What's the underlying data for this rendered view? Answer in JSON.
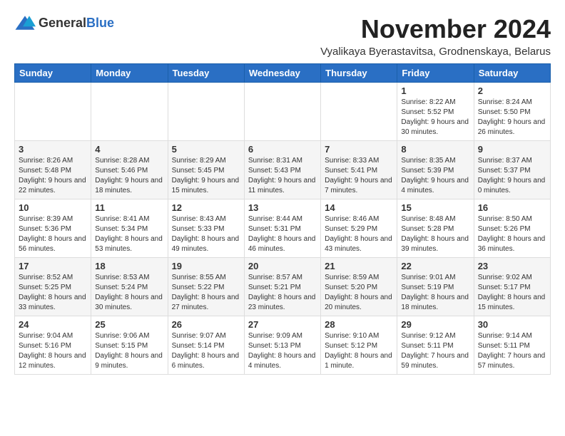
{
  "header": {
    "logo_general": "General",
    "logo_blue": "Blue",
    "month": "November 2024",
    "location": "Vyalikaya Byerastavitsa, Grodnenskaya, Belarus"
  },
  "weekdays": [
    "Sunday",
    "Monday",
    "Tuesday",
    "Wednesday",
    "Thursday",
    "Friday",
    "Saturday"
  ],
  "weeks": [
    [
      {
        "day": "",
        "sunrise": "",
        "sunset": "",
        "daylight": ""
      },
      {
        "day": "",
        "sunrise": "",
        "sunset": "",
        "daylight": ""
      },
      {
        "day": "",
        "sunrise": "",
        "sunset": "",
        "daylight": ""
      },
      {
        "day": "",
        "sunrise": "",
        "sunset": "",
        "daylight": ""
      },
      {
        "day": "",
        "sunrise": "",
        "sunset": "",
        "daylight": ""
      },
      {
        "day": "1",
        "sunrise": "8:22 AM",
        "sunset": "5:52 PM",
        "daylight": "9 hours and 30 minutes."
      },
      {
        "day": "2",
        "sunrise": "8:24 AM",
        "sunset": "5:50 PM",
        "daylight": "9 hours and 26 minutes."
      }
    ],
    [
      {
        "day": "3",
        "sunrise": "8:26 AM",
        "sunset": "5:48 PM",
        "daylight": "9 hours and 22 minutes."
      },
      {
        "day": "4",
        "sunrise": "8:28 AM",
        "sunset": "5:46 PM",
        "daylight": "9 hours and 18 minutes."
      },
      {
        "day": "5",
        "sunrise": "8:29 AM",
        "sunset": "5:45 PM",
        "daylight": "9 hours and 15 minutes."
      },
      {
        "day": "6",
        "sunrise": "8:31 AM",
        "sunset": "5:43 PM",
        "daylight": "9 hours and 11 minutes."
      },
      {
        "day": "7",
        "sunrise": "8:33 AM",
        "sunset": "5:41 PM",
        "daylight": "9 hours and 7 minutes."
      },
      {
        "day": "8",
        "sunrise": "8:35 AM",
        "sunset": "5:39 PM",
        "daylight": "9 hours and 4 minutes."
      },
      {
        "day": "9",
        "sunrise": "8:37 AM",
        "sunset": "5:37 PM",
        "daylight": "9 hours and 0 minutes."
      }
    ],
    [
      {
        "day": "10",
        "sunrise": "8:39 AM",
        "sunset": "5:36 PM",
        "daylight": "8 hours and 56 minutes."
      },
      {
        "day": "11",
        "sunrise": "8:41 AM",
        "sunset": "5:34 PM",
        "daylight": "8 hours and 53 minutes."
      },
      {
        "day": "12",
        "sunrise": "8:43 AM",
        "sunset": "5:33 PM",
        "daylight": "8 hours and 49 minutes."
      },
      {
        "day": "13",
        "sunrise": "8:44 AM",
        "sunset": "5:31 PM",
        "daylight": "8 hours and 46 minutes."
      },
      {
        "day": "14",
        "sunrise": "8:46 AM",
        "sunset": "5:29 PM",
        "daylight": "8 hours and 43 minutes."
      },
      {
        "day": "15",
        "sunrise": "8:48 AM",
        "sunset": "5:28 PM",
        "daylight": "8 hours and 39 minutes."
      },
      {
        "day": "16",
        "sunrise": "8:50 AM",
        "sunset": "5:26 PM",
        "daylight": "8 hours and 36 minutes."
      }
    ],
    [
      {
        "day": "17",
        "sunrise": "8:52 AM",
        "sunset": "5:25 PM",
        "daylight": "8 hours and 33 minutes."
      },
      {
        "day": "18",
        "sunrise": "8:53 AM",
        "sunset": "5:24 PM",
        "daylight": "8 hours and 30 minutes."
      },
      {
        "day": "19",
        "sunrise": "8:55 AM",
        "sunset": "5:22 PM",
        "daylight": "8 hours and 27 minutes."
      },
      {
        "day": "20",
        "sunrise": "8:57 AM",
        "sunset": "5:21 PM",
        "daylight": "8 hours and 23 minutes."
      },
      {
        "day": "21",
        "sunrise": "8:59 AM",
        "sunset": "5:20 PM",
        "daylight": "8 hours and 20 minutes."
      },
      {
        "day": "22",
        "sunrise": "9:01 AM",
        "sunset": "5:19 PM",
        "daylight": "8 hours and 18 minutes."
      },
      {
        "day": "23",
        "sunrise": "9:02 AM",
        "sunset": "5:17 PM",
        "daylight": "8 hours and 15 minutes."
      }
    ],
    [
      {
        "day": "24",
        "sunrise": "9:04 AM",
        "sunset": "5:16 PM",
        "daylight": "8 hours and 12 minutes."
      },
      {
        "day": "25",
        "sunrise": "9:06 AM",
        "sunset": "5:15 PM",
        "daylight": "8 hours and 9 minutes."
      },
      {
        "day": "26",
        "sunrise": "9:07 AM",
        "sunset": "5:14 PM",
        "daylight": "8 hours and 6 minutes."
      },
      {
        "day": "27",
        "sunrise": "9:09 AM",
        "sunset": "5:13 PM",
        "daylight": "8 hours and 4 minutes."
      },
      {
        "day": "28",
        "sunrise": "9:10 AM",
        "sunset": "5:12 PM",
        "daylight": "8 hours and 1 minute."
      },
      {
        "day": "29",
        "sunrise": "9:12 AM",
        "sunset": "5:11 PM",
        "daylight": "7 hours and 59 minutes."
      },
      {
        "day": "30",
        "sunrise": "9:14 AM",
        "sunset": "5:11 PM",
        "daylight": "7 hours and 57 minutes."
      }
    ]
  ]
}
